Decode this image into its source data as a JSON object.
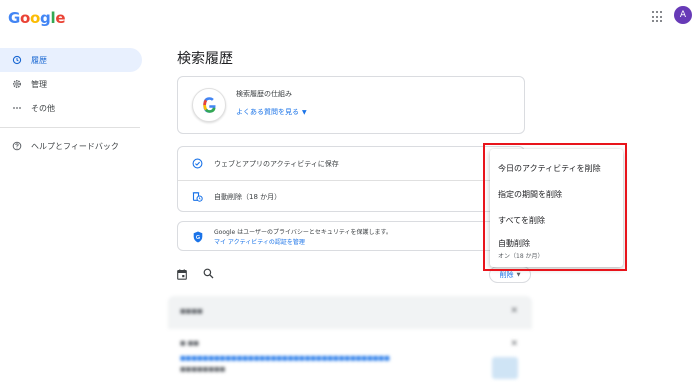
{
  "header": {
    "logo": "Google",
    "avatar_initial": "A"
  },
  "sidebar": {
    "items": [
      {
        "label": "履歴",
        "icon": "history-icon",
        "active": true
      },
      {
        "label": "管理",
        "icon": "gear-icon",
        "active": false
      },
      {
        "label": "その他",
        "icon": "more-horiz-icon",
        "active": false
      }
    ],
    "help": {
      "label": "ヘルプとフィードバック",
      "icon": "help-icon"
    }
  },
  "main": {
    "title": "検索履歴",
    "how_card": {
      "title": "検索履歴の仕組み",
      "link": "よくある質問を見る"
    },
    "settings": [
      {
        "label": "ウェブとアプリのアクティビティに保存",
        "icon": "check-circle-icon"
      },
      {
        "label": "自動削除（18 か月）",
        "icon": "auto-delete-icon"
      }
    ],
    "privacy": {
      "text": "Google はユーザーのプライバシーとセキュリティを保護します。",
      "link": "マイ アクティビティの認証を管理"
    },
    "toolbar": {
      "delete_label": "削除"
    }
  },
  "delete_menu": {
    "items": [
      {
        "label": "今日のアクティビティを削除"
      },
      {
        "label": "指定の期間を削除"
      },
      {
        "label": "すべてを削除"
      },
      {
        "label": "自動削除",
        "sub": "オン（18 か月）"
      }
    ]
  },
  "colors": {
    "accent": "#1a73e8",
    "highlight": "#e8141b",
    "active_bg": "#e8f0fe"
  }
}
